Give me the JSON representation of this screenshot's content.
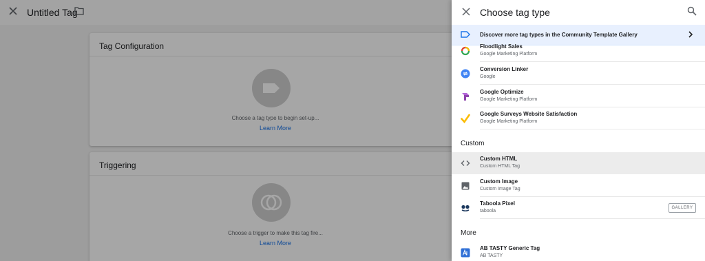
{
  "editor": {
    "title": "Untitled Tag",
    "config_card": {
      "title": "Tag Configuration",
      "hint": "Choose a tag type to begin set-up...",
      "learn_more": "Learn More"
    },
    "trigger_card": {
      "title": "Triggering",
      "hint": "Choose a trigger to make this tag fire...",
      "learn_more": "Learn More"
    }
  },
  "panel": {
    "title": "Choose tag type",
    "banner": "Discover more tag types in the Community Template Gallery",
    "featured_items": [
      {
        "name": "Floodlight Sales",
        "sub": "Google Marketing Platform",
        "icon": "floodlight-icon"
      },
      {
        "name": "Conversion Linker",
        "sub": "Google",
        "icon": "conversion-linker-icon"
      },
      {
        "name": "Google Optimize",
        "sub": "Google Marketing Platform",
        "icon": "google-optimize-icon"
      },
      {
        "name": "Google Surveys Website Satisfaction",
        "sub": "Google Marketing Platform",
        "icon": "google-surveys-icon"
      }
    ],
    "custom_section": "Custom",
    "custom_items": [
      {
        "name": "Custom HTML",
        "sub": "Custom HTML Tag",
        "icon": "code-icon"
      },
      {
        "name": "Custom Image",
        "sub": "Custom Image Tag",
        "icon": "image-icon"
      },
      {
        "name": "Taboola Pixel",
        "sub": "taboola",
        "icon": "taboola-icon",
        "badge": "GALLERY"
      }
    ],
    "more_section": "More",
    "more_items": [
      {
        "name": "AB TASTY Generic Tag",
        "sub": "AB TASTY",
        "icon": "ab-tasty-icon"
      }
    ]
  },
  "colors": {
    "accent": "#1a73e8",
    "banner_bg": "#e8f0fe"
  }
}
